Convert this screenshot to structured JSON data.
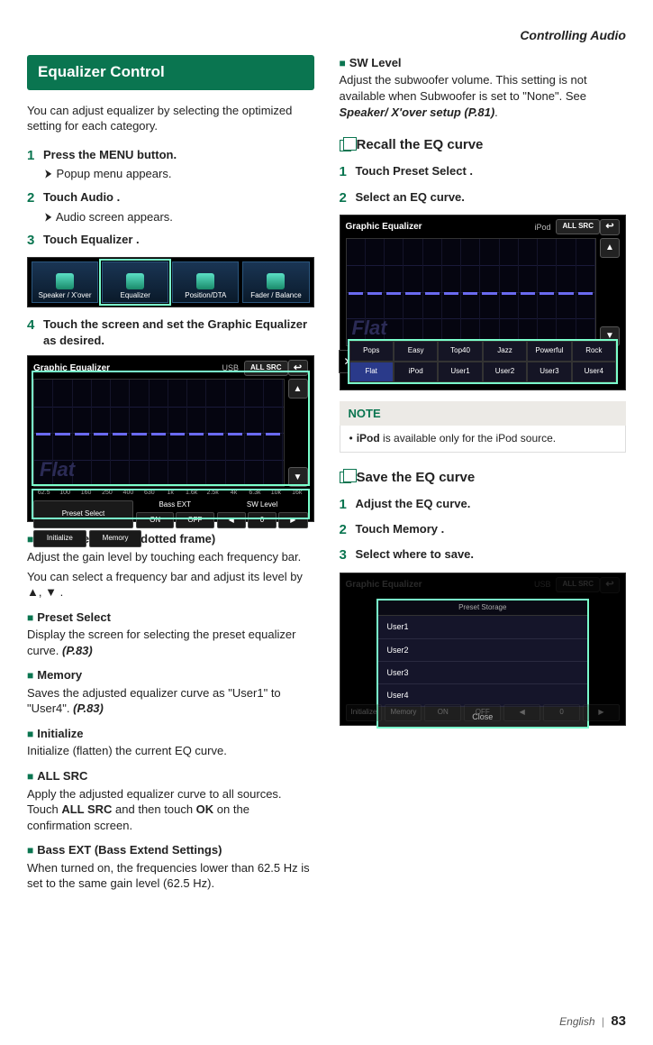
{
  "header": {
    "section": "Controlling Audio"
  },
  "title": "Equalizer Control",
  "intro": "You can adjust equalizer by selecting the optimized setting for each category.",
  "steps_left": [
    {
      "num": "1",
      "main_pre": "Press the ",
      "main_bold": "MENU",
      "main_post": " button.",
      "sub": "Popup menu appears."
    },
    {
      "num": "2",
      "main_pre": "Touch ",
      "main_bold": "Audio",
      "main_post": " .",
      "sub": "Audio screen appears."
    },
    {
      "num": "3",
      "main_pre": "Touch ",
      "main_bold": "Equalizer",
      "main_post": " ."
    },
    {
      "num": "4",
      "main": "Touch the screen and set the Graphic Equalizer as desired."
    }
  ],
  "scr1_cells": [
    "Speaker / X'over",
    "Equalizer",
    "Position/DTA",
    "Fader / Balance"
  ],
  "geq": {
    "title": "Graphic Equalizer",
    "src2": "USB",
    "src3": "iPod",
    "allsrc": "ALL SRC",
    "flat": "Flat",
    "freqs": [
      "62.5",
      "100",
      "160",
      "250",
      "400",
      "630",
      "1k",
      "1.6k",
      "2.5k",
      "4k",
      "6.3k",
      "10k",
      "16k"
    ],
    "bottom": {
      "preset": "Preset Select",
      "bassext": "Bass EXT",
      "swlevel": "SW Level",
      "init": "Initialize",
      "memory": "Memory",
      "on": "ON",
      "off": "OFF",
      "level": "0"
    }
  },
  "items": {
    "gain": {
      "title": "Gain level (area in dotted frame)",
      "d1": "Adjust the gain level by touching each frequency bar.",
      "d2a": "You can select a frequency bar and adjust its level by ",
      "d2b": "▲",
      "d2c": ", ",
      "d2d": "▼",
      "d2e": " ."
    },
    "preset": {
      "title": "Preset Select",
      "d": "Display the screen for selecting the preset equalizer curve. ",
      "ref": "(P.83)"
    },
    "memory": {
      "title": "Memory",
      "d": "Saves the adjusted equalizer curve as \"User1\" to \"User4\". ",
      "ref": "(P.83)"
    },
    "init": {
      "title": "Initialize",
      "d": "Initialize (flatten) the current EQ curve."
    },
    "allsrc": {
      "title": "ALL SRC",
      "d1": "Apply the adjusted equalizer curve to all sources. Touch ",
      "b1": "ALL SRC",
      "d2": " and then touch ",
      "b2": "OK",
      "d3": " on the confirmation screen."
    },
    "bassext": {
      "title": "Bass EXT",
      "suffix": " (Bass Extend Settings)",
      "d": "When turned on, the frequencies lower than 62.5 Hz is set to the same gain level (62.5 Hz)."
    },
    "sw": {
      "title": "SW Level",
      "d1": "Adjust the subwoofer volume. This setting is not available when Subwoofer is set to \"None\". See ",
      "ref": "Speaker/ X'over setup (P.81)",
      "d2": "."
    }
  },
  "recall": {
    "heading": "Recall the EQ curve",
    "s1_pre": "Touch ",
    "s1_b": "Preset Select",
    "s1_post": " .",
    "s2": "Select an EQ curve.",
    "presets_r1": [
      "Pops",
      "Easy",
      "Top40",
      "Jazz",
      "Powerful",
      "Rock"
    ],
    "presets_r2": [
      "Flat",
      "iPod",
      "User1",
      "User2",
      "User3",
      "User4"
    ]
  },
  "note": {
    "label": "NOTE",
    "b": "iPod",
    "text": " is available only for the iPod source."
  },
  "save": {
    "heading": "Save the EQ curve",
    "s1": "Adjust the EQ curve.",
    "s2_pre": "Touch ",
    "s2_b": "Memory",
    "s2_post": " .",
    "s3": "Select where to save.",
    "storage_title": "Preset Storage",
    "users": [
      "User1",
      "User2",
      "User3",
      "User4"
    ],
    "close": "Close"
  },
  "footer": {
    "lang": "English",
    "page": "83"
  }
}
